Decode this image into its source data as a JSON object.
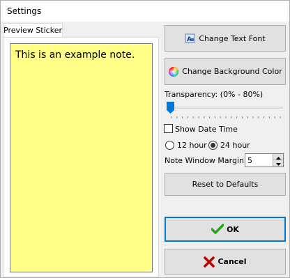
{
  "window": {
    "title": "Settings"
  },
  "tabs": [
    {
      "label": "Preview Sticker"
    }
  ],
  "preview": {
    "note_text": "This is an example note.",
    "note_bg": "#ffff88"
  },
  "buttons": {
    "change_font": "Change Text Font",
    "change_bg": "Change Background Color",
    "reset": "Reset to Defaults",
    "ok": "OK",
    "cancel": "Cancel"
  },
  "transparency": {
    "label": "Transparency: (0% - 80%)",
    "value_percent": 0
  },
  "show_date_time": {
    "label": "Show Date Time",
    "checked": false
  },
  "hour_format": {
    "options": [
      "12 hour",
      "24 hour"
    ],
    "selected": "24 hour"
  },
  "margin": {
    "label": "Note Window Margin:",
    "value": "5"
  },
  "colors": {
    "accent": "#0078d7",
    "ok_check": "#2aa11f",
    "cancel_x": "#b80000"
  },
  "icons": [
    "font-icon",
    "color-wheel-icon",
    "check-icon",
    "x-icon",
    "chevron-up-icon",
    "chevron-down-icon"
  ]
}
